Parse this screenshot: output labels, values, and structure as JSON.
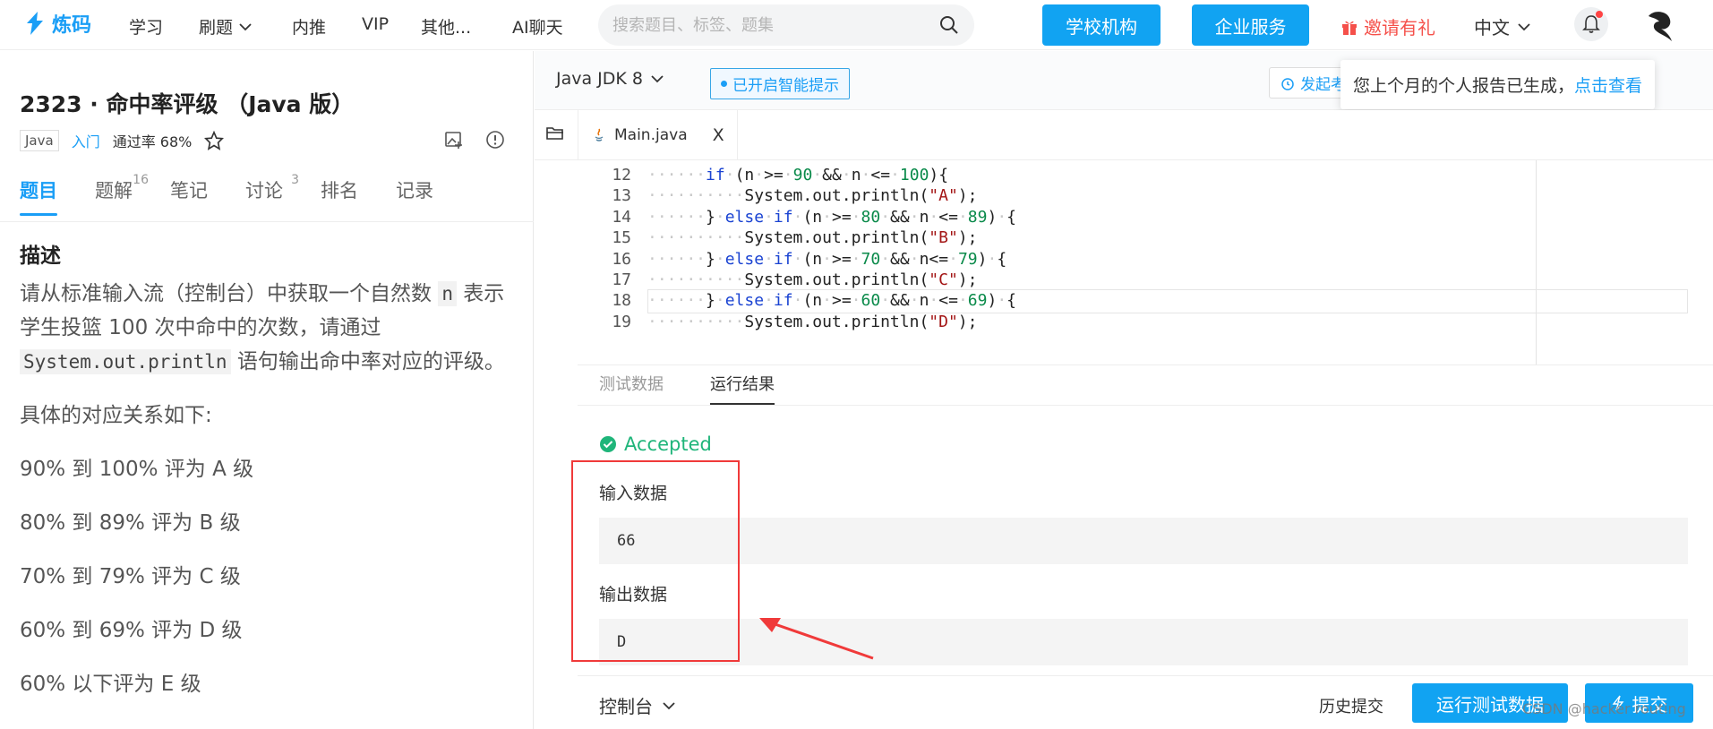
{
  "header": {
    "logo_text": "炼码",
    "nav": [
      "学习",
      "刷题",
      "内推",
      "VIP",
      "其他...",
      "AI聊天"
    ],
    "search_placeholder": "搜索题目、标签、题集",
    "school_btn": "学校机构",
    "enterprise_btn": "企业服务",
    "invite": "邀请有礼",
    "language": "中文"
  },
  "problem": {
    "title": "2323 · 命中率评级 （Java 版）",
    "lang_tag": "Java",
    "level": "入门",
    "pass_rate": "通过率 68%",
    "tabs": [
      {
        "label": "题目",
        "count": ""
      },
      {
        "label": "题解",
        "count": "16"
      },
      {
        "label": "笔记",
        "count": ""
      },
      {
        "label": "讨论",
        "count": "3"
      },
      {
        "label": "排名",
        "count": ""
      },
      {
        "label": "记录",
        "count": ""
      }
    ],
    "desc_heading": "描述",
    "desc_p1_a": "请从标准输入流（控制台）中获取一个自然数 ",
    "desc_code_n": "n",
    "desc_p1_b": " 表示学生投篮 100 次中命中的次数，请通过 ",
    "desc_code_println": "System.out.println",
    "desc_p1_c": " 语句输出命中率对应的评级。",
    "desc_p2": "具体的对应关系如下:",
    "grades": [
      "90% 到 100% 评为 A 级",
      "80% 到 89% 评为 B 级",
      "70% 到 79% 评为 C 级",
      "60% 到 69% 评为 D 级",
      "60% 以下评为 E 级"
    ]
  },
  "editor": {
    "jdk": "Java JDK 8",
    "smart_hint": "已开启智能提示",
    "fab_label": "发起考",
    "toast_text": "您上个月的个人报告已生成，",
    "toast_link": "点击查看",
    "file_tab": "Main.java",
    "close": "X",
    "lines": [
      {
        "n": "12",
        "indent": "······",
        "parts": [
          [
            "kw",
            "if"
          ],
          [
            "",
            "·(n·>=·"
          ],
          [
            "num",
            "90"
          ],
          [
            "",
            "·&&·n·<=·"
          ],
          [
            "num",
            "100"
          ],
          [
            "",
            "){"
          ]
        ]
      },
      {
        "n": "13",
        "indent": "··········",
        "parts": [
          [
            "",
            "System.out.println("
          ],
          [
            "str",
            "\"A\""
          ],
          [
            "",
            ");"
          ]
        ]
      },
      {
        "n": "14",
        "indent": "······",
        "parts": [
          [
            "",
            "}·"
          ],
          [
            "kw",
            "else"
          ],
          [
            "",
            "·"
          ],
          [
            "kw",
            "if"
          ],
          [
            "",
            "·(n·>=·"
          ],
          [
            "num",
            "80"
          ],
          [
            "",
            "·&&·n·<=·"
          ],
          [
            "num",
            "89"
          ],
          [
            "",
            ")·{"
          ]
        ]
      },
      {
        "n": "15",
        "indent": "··········",
        "parts": [
          [
            "",
            "System.out.println("
          ],
          [
            "str",
            "\"B\""
          ],
          [
            "",
            ");"
          ]
        ]
      },
      {
        "n": "16",
        "indent": "······",
        "parts": [
          [
            "",
            "}·"
          ],
          [
            "kw",
            "else"
          ],
          [
            "",
            "·"
          ],
          [
            "kw",
            "if"
          ],
          [
            "",
            "·(n·>=·"
          ],
          [
            "num",
            "70"
          ],
          [
            "",
            "·&&·n<=·"
          ],
          [
            "num",
            "79"
          ],
          [
            "",
            ")·{"
          ]
        ]
      },
      {
        "n": "17",
        "indent": "··········",
        "parts": [
          [
            "",
            "System.out.println("
          ],
          [
            "str",
            "\"C\""
          ],
          [
            "",
            ");"
          ]
        ]
      },
      {
        "n": "18",
        "indent": "······",
        "parts": [
          [
            "",
            "}·"
          ],
          [
            "kw",
            "else"
          ],
          [
            "",
            "·"
          ],
          [
            "kw",
            "if"
          ],
          [
            "",
            "·(n·>=·"
          ],
          [
            "num",
            "60"
          ],
          [
            "",
            "·&&·n·<=·"
          ],
          [
            "num",
            "69"
          ],
          [
            "",
            ")·{"
          ]
        ]
      },
      {
        "n": "19",
        "indent": "··········",
        "parts": [
          [
            "",
            "System.out.println("
          ],
          [
            "str",
            "\"D\""
          ],
          [
            "",
            ");"
          ]
        ]
      }
    ]
  },
  "result": {
    "tab_test": "测试数据",
    "tab_result": "运行结果",
    "status": "Accepted",
    "input_label": "输入数据",
    "input_value": "66",
    "output_label": "输出数据",
    "output_value": "D",
    "console": "控制台",
    "history": "历史提交",
    "run_btn": "运行测试数据",
    "submit_btn": "提交"
  },
  "watermark": "CSDN @hacker routing",
  "colors": {
    "brand": "#1a9ef6",
    "button": "#11a3f2",
    "accepted": "#1fb57a",
    "annotation": "#f03a3a"
  }
}
